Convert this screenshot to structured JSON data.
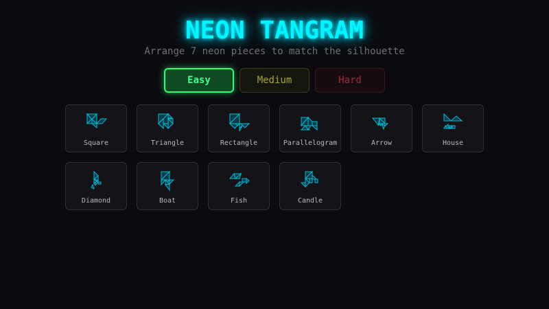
{
  "header": {
    "title": "NEON TANGRAM",
    "subtitle": "Arrange 7 neon pieces to match the silhouette"
  },
  "difficulty": {
    "selected": "Easy",
    "options": [
      {
        "label": "Easy",
        "color": "#2bff7a"
      },
      {
        "label": "Medium",
        "color": "#a6a62c"
      },
      {
        "label": "Hard",
        "color": "#a32c31"
      }
    ]
  },
  "theme": {
    "accent": "#00f5ff",
    "piece_stroke": "#00bcd4",
    "piece_fill": "#0d3a4a"
  },
  "puzzles": [
    {
      "label": "Square",
      "icon": "square-silhouette-icon"
    },
    {
      "label": "Triangle",
      "icon": "triangle-silhouette-icon"
    },
    {
      "label": "Rectangle",
      "icon": "rectangle-silhouette-icon"
    },
    {
      "label": "Parallelogram",
      "icon": "parallelogram-silhouette-icon"
    },
    {
      "label": "Arrow",
      "icon": "arrow-silhouette-icon"
    },
    {
      "label": "House",
      "icon": "house-silhouette-icon"
    },
    {
      "label": "Diamond",
      "icon": "diamond-silhouette-icon"
    },
    {
      "label": "Boat",
      "icon": "boat-silhouette-icon"
    },
    {
      "label": "Fish",
      "icon": "fish-silhouette-icon"
    },
    {
      "label": "Candle",
      "icon": "candle-silhouette-icon"
    }
  ]
}
